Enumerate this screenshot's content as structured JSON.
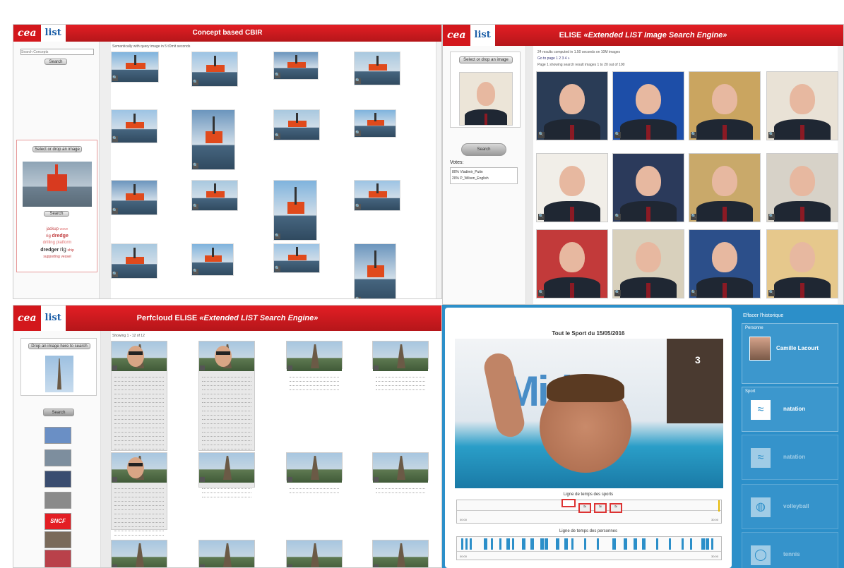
{
  "p1": {
    "title": "Concept based CBIR",
    "logo_cea": "cea",
    "logo_list": "list",
    "search_placeholder": "Search Concepts",
    "search_btn": "Search",
    "result_info": "Semantically with query image in 5 tOmit seconds",
    "drop_label": "Select or drop an image",
    "search2_btn": "Search",
    "tags": [
      "jackup",
      "wave",
      "rig",
      "dredge",
      "drilling",
      "platform",
      "dredger",
      "rig",
      "ship",
      "supporting",
      "vessel"
    ],
    "mag": "🔍"
  },
  "p2": {
    "title": "ELISE «Extended LIST Image Search Engine»",
    "title_plain": "ELISE",
    "title_italic": "«Extended LIST Image Search Engine»",
    "logo_cea": "cea",
    "logo_list": "list",
    "drop_label": "Select or drop an image",
    "search_btn": "Search",
    "results": "24 results computed in 1.50 seconds on 10M images",
    "pages": "Go to page 1 2 3 4 »",
    "showing": "Page 1 showing search result images 1 to 20 out of 100",
    "votes_label": "Votes:",
    "votes": [
      "80% Vladimir_Putin",
      "20% P_Wilson_English"
    ],
    "mag": "🔍"
  },
  "p3": {
    "title_plain": "Perfcloud ELISE",
    "title_italic": "«Extended LIST Search Engine»",
    "logo_cea": "cea",
    "logo_list": "list",
    "drop_label": "Drop an image here to search",
    "search_btn": "Search",
    "showing": "Showing 1 - 12 of 12",
    "brand": "SNCF",
    "mag": "🔍"
  },
  "p4": {
    "video_title": "Tout le Sport du 15/05/2016",
    "timeline1": "Ligne de temps des sports",
    "timeline2": "Ligne de temps des personnes",
    "channel": "3",
    "sidebar_title": "Effacer l'historique",
    "person_label": "Personne",
    "person_name": "Camille Lacourt",
    "sport_label": "Sport",
    "sports": [
      "natation",
      "natation",
      "volleyball",
      "tennis"
    ],
    "time_start": "00:00",
    "time_end": "30:00"
  },
  "colors": {
    "red": "#e31e24",
    "blue": "#2c8fc9"
  }
}
